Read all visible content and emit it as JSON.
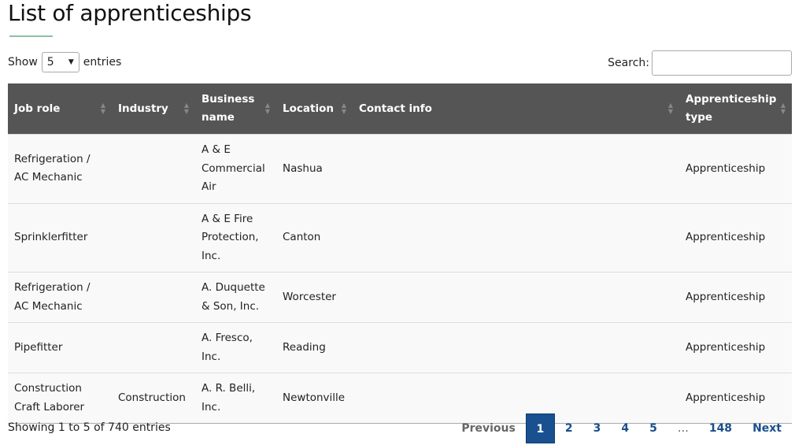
{
  "title": "List of apprenticeships",
  "length": {
    "show": "Show",
    "value": "5",
    "entries": "entries"
  },
  "search": {
    "label": "Search:",
    "value": ""
  },
  "columns": [
    "Job role",
    "Industry",
    "Business name",
    "Location",
    "Contact info",
    "Apprenticeship type"
  ],
  "rows": [
    [
      "Refrigeration / AC Mechanic",
      "",
      "A & E Commercial Air",
      "Nashua",
      "",
      "Apprenticeship"
    ],
    [
      "Sprinklerfitter",
      "",
      "A & E Fire Protection, Inc.",
      "Canton",
      "",
      "Apprenticeship"
    ],
    [
      "Refrigeration / AC Mechanic",
      "",
      "A. Duquette & Son, Inc.",
      "Worcester",
      "",
      "Apprenticeship"
    ],
    [
      "Pipefitter",
      "",
      "A. Fresco, Inc.",
      "Reading",
      "",
      "Apprenticeship"
    ],
    [
      "Construction Craft Laborer",
      "Construction",
      "A. R. Belli, Inc.",
      "Newtonville",
      "",
      "Apprenticeship"
    ]
  ],
  "info": "Showing 1 to 5 of 740 entries",
  "pagination": {
    "previous": "Previous",
    "pages": [
      "1",
      "2",
      "3",
      "4",
      "5"
    ],
    "ellipsis": "…",
    "last": "148",
    "next": "Next",
    "current": "1"
  },
  "colors": {
    "header": "#555555",
    "accent": "#8cc1a6",
    "current_page": "#195190"
  }
}
